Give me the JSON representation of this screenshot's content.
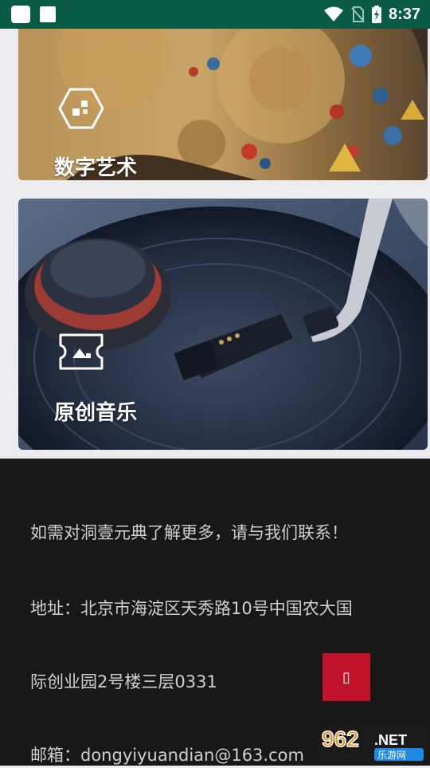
{
  "status_bar": {
    "time": "8:37",
    "icons": [
      "notification-square-icon",
      "notification-square-icon",
      "wifi-icon",
      "no-sim-icon",
      "battery-charging-icon"
    ]
  },
  "cards": [
    {
      "title": "数字艺术",
      "icon": "hexagon-icon"
    },
    {
      "title": "原创音乐",
      "icon": "ticket-image-icon"
    }
  ],
  "footer": {
    "intro": "如需对洞壹元典了解更多，请与我们联系！",
    "address_line1": "地址：北京市海淀区天秀路10号中国农大国",
    "address_line2": "际创业园2号楼三层0331",
    "email": "邮箱：dongyiyuandian@163.com"
  },
  "fab": {
    "icon": "missing-glyph-icon",
    "label": "▯"
  },
  "watermark": {
    "number": "962",
    "suffix": ".NET",
    "cn": "乐游网"
  }
}
